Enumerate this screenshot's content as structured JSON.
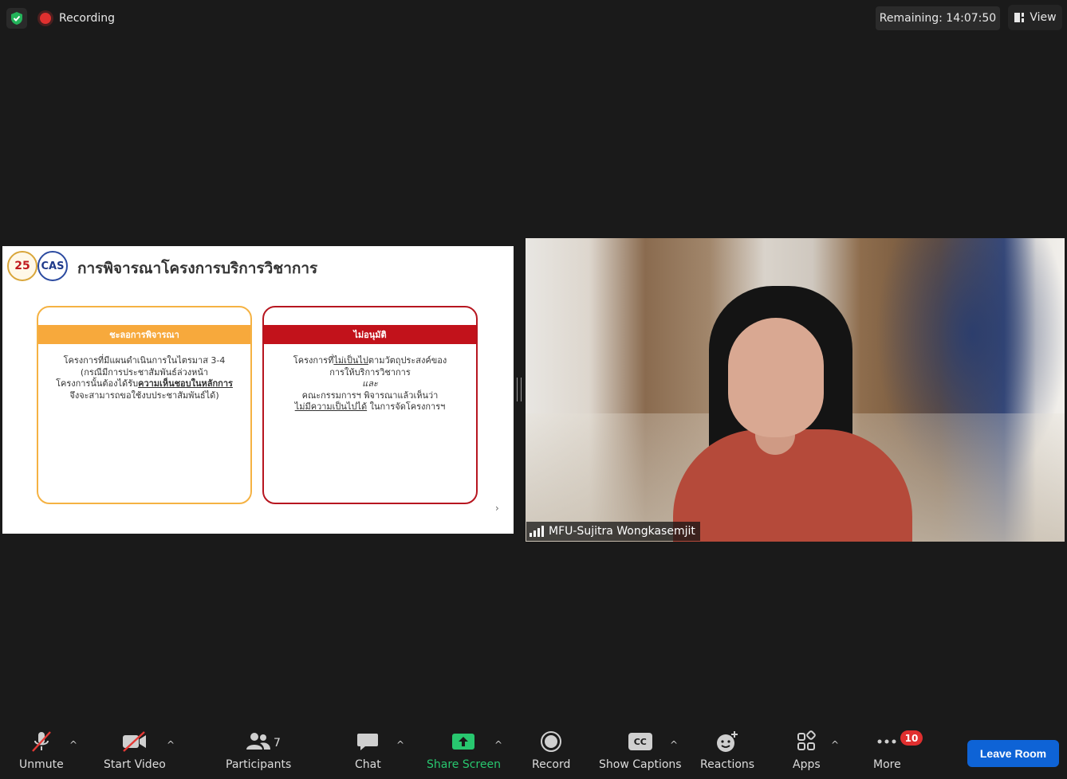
{
  "topbar": {
    "recording_label": "Recording",
    "remaining_label": "Remaining: 14:07:50",
    "view_label": "View"
  },
  "slide": {
    "logo_left_text": "25",
    "logo_right_text": "CAS",
    "title": "การพิจารณาโครงการบริการวิชาการ",
    "card_left": {
      "header": "ชะลอการพิจารณา",
      "line1": "โครงการที่มีแผนดำเนินการในไตรมาส 3-4",
      "line2": "(กรณีมีการประชาสัมพันธ์ล่วงหน้า",
      "line3_pre": "โครงการนั้นต้องได้รับ",
      "line3_u": "ความเห็นชอบในหลักการ",
      "line4": "จึงจะสามารถขอใช้งบประชาสัมพันธ์ได้)"
    },
    "card_right": {
      "header": "ไม่อนุมัติ",
      "line1_pre": "โครงการที่",
      "line1_u": "ไม่เป็นไป",
      "line1_post": "ตามวัตถุประสงค์ของ",
      "line2": "การให้บริการวิชาการ",
      "line3": "และ",
      "line4": "คณะกรรมการฯ พิจารณาแล้วเห็นว่า",
      "line5_u": "ไม่มีความเป็นไปได้",
      "line5_post": " ในการจัดโครงการฯ"
    },
    "next_arrow": "›"
  },
  "video": {
    "participant_name": "MFU-Sujitra Wongkasemjit"
  },
  "toolbar": {
    "unmute": "Unmute",
    "start_video": "Start Video",
    "participants": "Participants",
    "participants_count": "7",
    "chat": "Chat",
    "share_screen": "Share Screen",
    "record": "Record",
    "show_captions": "Show Captions",
    "captions_icon_text": "CC",
    "reactions": "Reactions",
    "apps": "Apps",
    "more": "More",
    "more_badge": "10",
    "leave_room": "Leave Room",
    "caret": "^"
  },
  "colors": {
    "accent_green": "#28c76f",
    "leave_blue": "#0e63d6",
    "badge_red": "#e02f2f",
    "card_orange": "#f7a93c",
    "card_red": "#c2121b"
  }
}
